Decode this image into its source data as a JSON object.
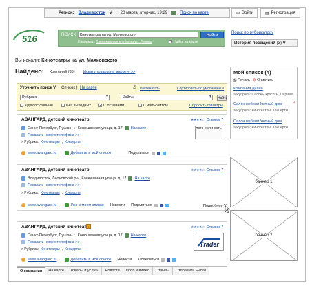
{
  "topbar": {
    "region_label": "Регион:",
    "region_value": "Владивосток",
    "region_arrow": "V",
    "date": "20 марта, вторник, 19:29",
    "map_search": "Поиск по карте"
  },
  "auth": {
    "login": "Войти",
    "register": "Регистрация"
  },
  "search": {
    "label": "ПОИСК",
    "value": "Кинотеатры на ул. Маяковского",
    "button": "Найти",
    "example_prefix": "Например,",
    "example_link": "Тренажерные клубы на ул. Ленина",
    "on_map_label": "Найти на карте"
  },
  "rubricator_link": "Поиск по рубрикатору",
  "history": {
    "label": "История посещений",
    "count": "(3)",
    "arrow": "V"
  },
  "query": {
    "prefix": "Вы искали:",
    "text": "Кинотеатры на ул. Маяковского"
  },
  "found": {
    "label": "Найдено:",
    "companies": "Компаний (35)",
    "market_link": "Искать товары на маркете >>"
  },
  "filters": {
    "refine": "Уточнить поиск V",
    "list": "Список",
    "sep": "|",
    "on_map": "На карте",
    "print": "Распечатать",
    "sort": "Сортировать по умолчанию v",
    "rubric_placeholder": "Рубрика",
    "district_placeholder": "Район",
    "find": "Найти",
    "opts": [
      "Круглосуточные",
      "Без выходных",
      "С отзывами",
      "С web-сайтом"
    ],
    "reset": "Сбросить фильтры"
  },
  "cards": [
    {
      "title": "АВАНГАРД, детский кинотеатр",
      "address": "Санкт-Петербург, Пушкин г., Конюшенная улица, д. 17",
      "map": "На карте",
      "phone": "Показать номер телефона >>",
      "rubric_label": "> Рубрика:",
      "rubric_1": "Кинотеатры",
      "rubric_2": "Концерты",
      "site": "www.avangard.ru",
      "add": "Добавить в мой список",
      "share": "Поделиться",
      "reviews": "Отзывов 7",
      "logo": "лого если есть",
      "stars": "★★★★☆"
    },
    {
      "title": "АВАНГАРД, детский кинотеатр",
      "address": "Владивосток, Леоновский р-н, Конюшенная улица, д. 17",
      "map": "На карте",
      "phone": "Показать номер телефона >>",
      "rubric_label": "> Рубрика:",
      "rubric_1": "Кинотеатры",
      "rubric_2": "Концерты",
      "site": "www.avangard.ru",
      "add": "Уже в моем списке",
      "news": "Новости",
      "share": "Поделиться",
      "reviews": "Отзывов 7",
      "more": "Подробнее V",
      "stars": "★★★★☆"
    },
    {
      "title": "АВАНГАРД, детский кинотеатр",
      "address": "Санкт-Петербург, Пушкин г., Конюшенная улица, д. 17",
      "map": "На карте",
      "phone": "Показать номер телефона >>",
      "rubric_label": "> Рубрика:",
      "rubric_1": "Кинотеатры",
      "rubric_2": "Концерты",
      "site": "www.avangard.ru",
      "add": "Добавить в мой список",
      "news": "Новости",
      "share": "Поделиться",
      "reviews": "Отзывов 7",
      "logo": "Trader",
      "stars": "★★★★☆"
    }
  ],
  "mylist": {
    "title": "Мой список (4)",
    "print": "Печать",
    "clear": "Очистить",
    "items": [
      {
        "name": "Компания Диана",
        "sub": "> Рубрика: Салоны красоты, Парикм..."
      },
      {
        "name": "Салон мебели Уютный дом",
        "sub": "> Рубрика: Кинотеатры, Концерты"
      },
      {
        "name": "Салон мебели Уютный дом",
        "sub": "> Рубрика: Кинотеатры, Концерты"
      }
    ]
  },
  "banners": [
    "баннер 1",
    "баннер 2"
  ],
  "tabs": [
    "О компании",
    "На карте",
    "Товары и услуги",
    "Новости",
    "Фото и видео",
    "Отзывы",
    "Отправить E-mail"
  ]
}
